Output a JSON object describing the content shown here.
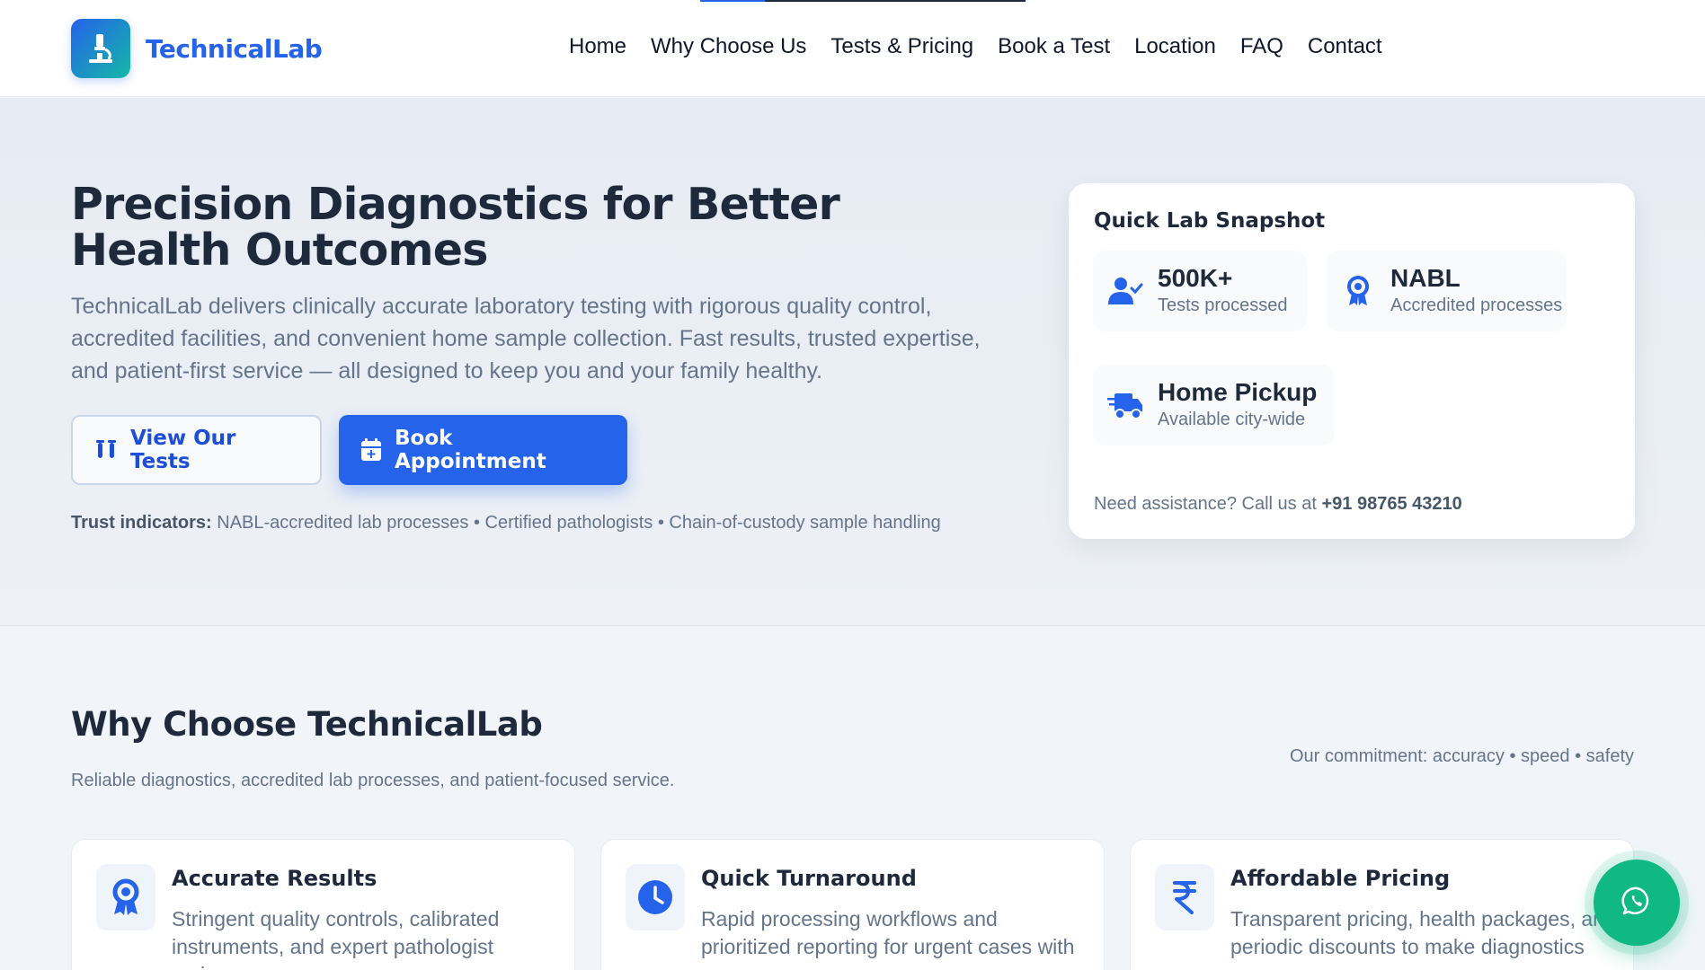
{
  "brand": {
    "name": "TechnicalLab"
  },
  "nav": {
    "items": [
      "Home",
      "Why Choose Us",
      "Tests & Pricing",
      "Book a Test",
      "Location",
      "FAQ",
      "Contact"
    ]
  },
  "hero": {
    "title": "Precision Diagnostics for Better Health Outcomes",
    "description": "TechnicalLab delivers clinically accurate laboratory testing with rigorous quality control, accredited facilities, and convenient home sample collection. Fast results, trusted expertise, and patient-first service — all designed to keep you and your family healthy.",
    "view_tests_label": "View Our Tests",
    "book_label": "Book Appointment",
    "trust_label": "Trust indicators:",
    "trust_text": "NABL-accredited lab processes • Certified pathologists • Chain-of-custody sample handling"
  },
  "snapshot": {
    "title": "Quick Lab Snapshot",
    "stats": [
      {
        "value": "500K+",
        "label": "Tests processed",
        "icon": "user-check-icon"
      },
      {
        "value": "NABL",
        "label": "Accredited processes",
        "icon": "award-icon"
      },
      {
        "value": "Home Pickup",
        "label": "Available city-wide",
        "icon": "truck-icon"
      }
    ],
    "help_text": "Need assistance? Call us at",
    "phone": "+91 98765 43210"
  },
  "why": {
    "title": "Why Choose TechnicalLab",
    "subtitle": "Reliable diagnostics, accredited lab processes, and patient-focused service.",
    "commitment": "Our commitment: accuracy • speed • safety",
    "features": [
      {
        "title": "Accurate Results",
        "desc": "Stringent quality controls, calibrated instruments, and expert pathologist review",
        "icon": "award-icon"
      },
      {
        "title": "Quick Turnaround",
        "desc": "Rapid processing workflows and prioritized reporting for urgent cases with",
        "icon": "clock-icon"
      },
      {
        "title": "Affordable Pricing",
        "desc": "Transparent pricing, health packages, and periodic discounts to make diagnostics",
        "icon": "rupee-icon"
      }
    ]
  },
  "colors": {
    "primary": "#2563eb",
    "whatsapp": "#10b981",
    "text": "#1e293b",
    "muted": "#64748b"
  }
}
